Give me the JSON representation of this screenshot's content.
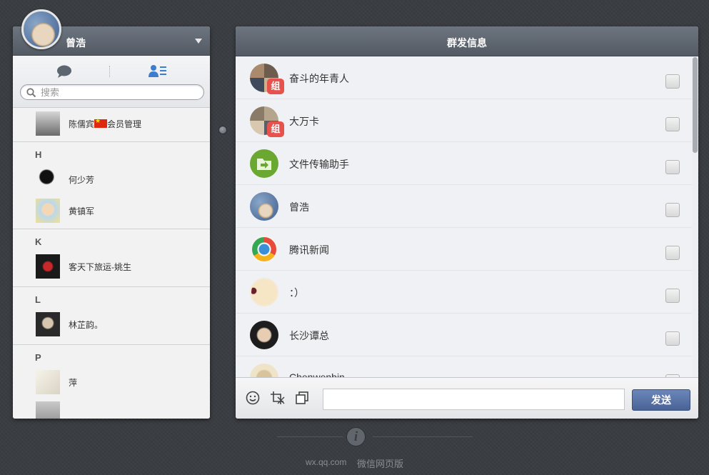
{
  "user": {
    "name": "曾浩"
  },
  "search": {
    "placeholder": "搜索"
  },
  "contacts": {
    "first": {
      "name_pre": "陈儒宾",
      "name_post": "会员管理"
    },
    "groups": [
      {
        "letter": "H",
        "items": [
          "何少芳",
          "黄镇军"
        ]
      },
      {
        "letter": "K",
        "items": [
          "客天下旅运-姚生"
        ]
      },
      {
        "letter": "L",
        "items": [
          "林芷韵。"
        ]
      },
      {
        "letter": "P",
        "items": [
          "萍"
        ]
      }
    ]
  },
  "panel": {
    "title": "群发信息",
    "group_badge": "组",
    "items": [
      {
        "name": "奋斗的年青人"
      },
      {
        "name": "大万卡"
      },
      {
        "name": "文件传输助手"
      },
      {
        "name": "曾浩"
      },
      {
        "name": "腾讯新闻"
      },
      {
        "name": "：）"
      },
      {
        "name": "长沙谭总"
      },
      {
        "name": "Chenwenbin"
      }
    ]
  },
  "composer": {
    "send_label": "发送"
  },
  "footer": {
    "url": "wx.qq.com",
    "site_name": "微信网页版",
    "info_glyph": "i"
  },
  "colors": {
    "header": "#5f6771",
    "send": "#5671a6",
    "badge": "#e8524d",
    "page_bg": "#3a3d42"
  }
}
